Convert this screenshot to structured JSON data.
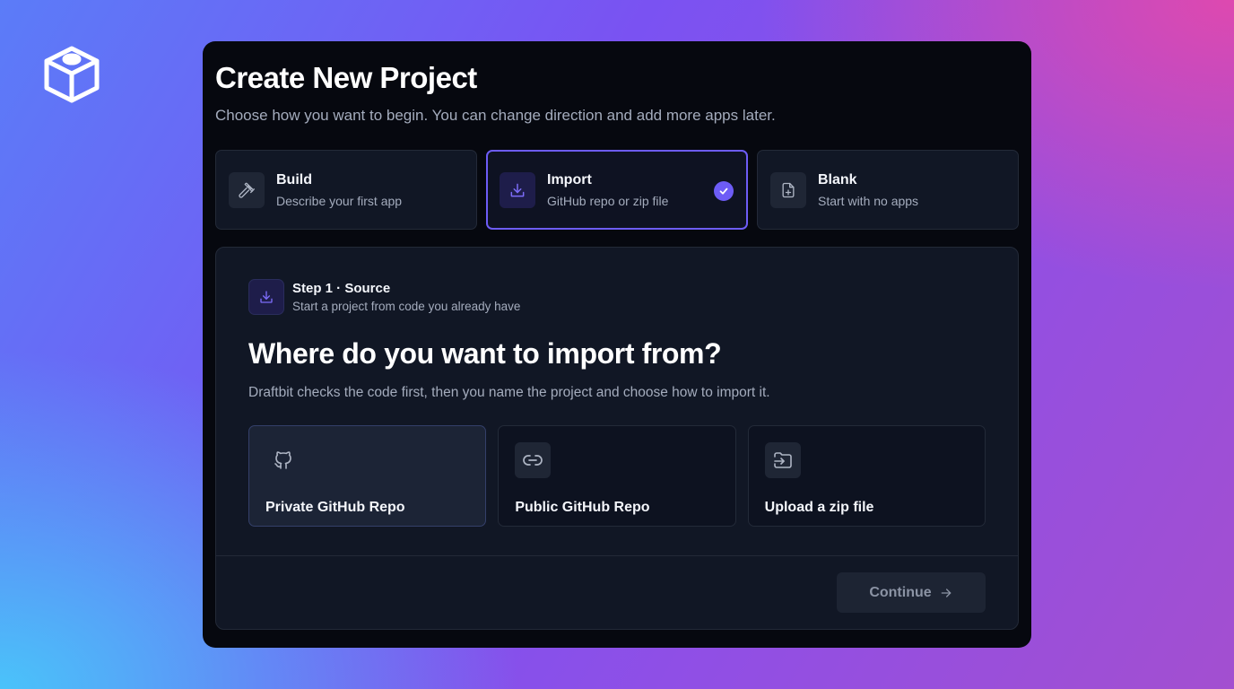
{
  "app": {
    "logo_icon": "cube-logo-icon"
  },
  "modal": {
    "title": "Create New Project",
    "subtitle": "Choose how you want to begin. You can change direction and add more apps later."
  },
  "options": [
    {
      "title": "Build",
      "description": "Describe your first app",
      "icon": "hammer-icon",
      "selected": false
    },
    {
      "title": "Import",
      "description": "GitHub repo or zip file",
      "icon": "download-icon",
      "selected": true
    },
    {
      "title": "Blank",
      "description": "Start with no apps",
      "icon": "file-plus-icon",
      "selected": false
    }
  ],
  "step": {
    "title": "Step 1 · Source",
    "description": "Start a project from code you already have",
    "icon": "download-icon"
  },
  "import": {
    "heading": "Where do you want to import from?",
    "description": "Draftbit checks the code first, then you name the project and choose how to import it."
  },
  "sources": [
    {
      "label": "Private GitHub Repo",
      "icon": "github-icon",
      "selected": true
    },
    {
      "label": "Public GitHub Repo",
      "icon": "link-icon",
      "selected": false
    },
    {
      "label": "Upload a zip file",
      "icon": "folder-import-icon",
      "selected": false
    }
  ],
  "footer": {
    "continue_label": "Continue",
    "continue_icon": "arrow-right-icon"
  },
  "colors": {
    "accent": "#6d5cf6",
    "modal_bg": "#06080f",
    "card_bg": "#111725",
    "muted_text": "#a4acbd"
  }
}
